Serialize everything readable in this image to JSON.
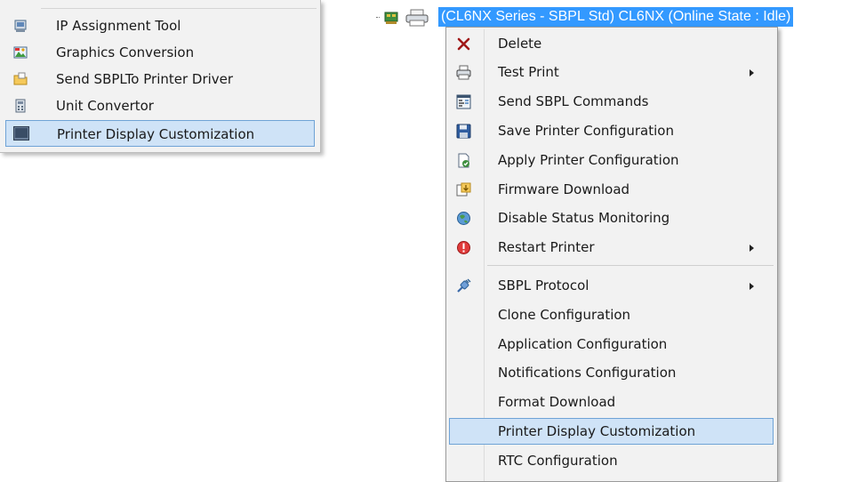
{
  "left_menu": {
    "items": [
      {
        "label": "IP Assignment Tool",
        "icon": "network-tool-icon"
      },
      {
        "label": "Graphics Conversion",
        "icon": "picture-icon"
      },
      {
        "label": "Send SBPLTo Printer Driver",
        "icon": "folder-icon"
      },
      {
        "label": "Unit Convertor",
        "icon": "calculator-icon"
      },
      {
        "label": "Printer Display Customization",
        "icon": "display-panel-icon",
        "selected": true
      }
    ]
  },
  "tree": {
    "node_label": "(CL6NX Series - SBPL Std) CL6NX (Online State : Idle)",
    "selection_color": "#3399ff"
  },
  "context_menu": {
    "items": [
      {
        "label": "Delete",
        "icon": "delete-x-icon"
      },
      {
        "label": "Test Print",
        "icon": "printer-icon",
        "submenu": true
      },
      {
        "label": "Send SBPL Commands",
        "icon": "command-window-icon"
      },
      {
        "label": "Save Printer Configuration",
        "icon": "floppy-disk-icon"
      },
      {
        "label": "Apply Printer Configuration",
        "icon": "apply-config-icon"
      },
      {
        "label": "Firmware Download",
        "icon": "firmware-download-icon"
      },
      {
        "label": "Disable Status Monitoring",
        "icon": "globe-icon"
      },
      {
        "label": "Restart Printer",
        "icon": "alert-icon",
        "submenu": true
      },
      {
        "label": "SBPL Protocol",
        "icon": "plug-icon",
        "submenu": true
      },
      {
        "label": "Clone Configuration",
        "icon": ""
      },
      {
        "label": "Application Configuration",
        "icon": ""
      },
      {
        "label": "Notifications Configuration",
        "icon": ""
      },
      {
        "label": "Format Download",
        "icon": ""
      },
      {
        "label": "Printer Display Customization",
        "icon": "",
        "selected": true
      },
      {
        "label": "RTC Configuration",
        "icon": ""
      }
    ]
  },
  "colors": {
    "menu_bg": "#f2f2f2",
    "highlight_bg": "#cfe3f7",
    "highlight_border": "#6fa3d6"
  }
}
